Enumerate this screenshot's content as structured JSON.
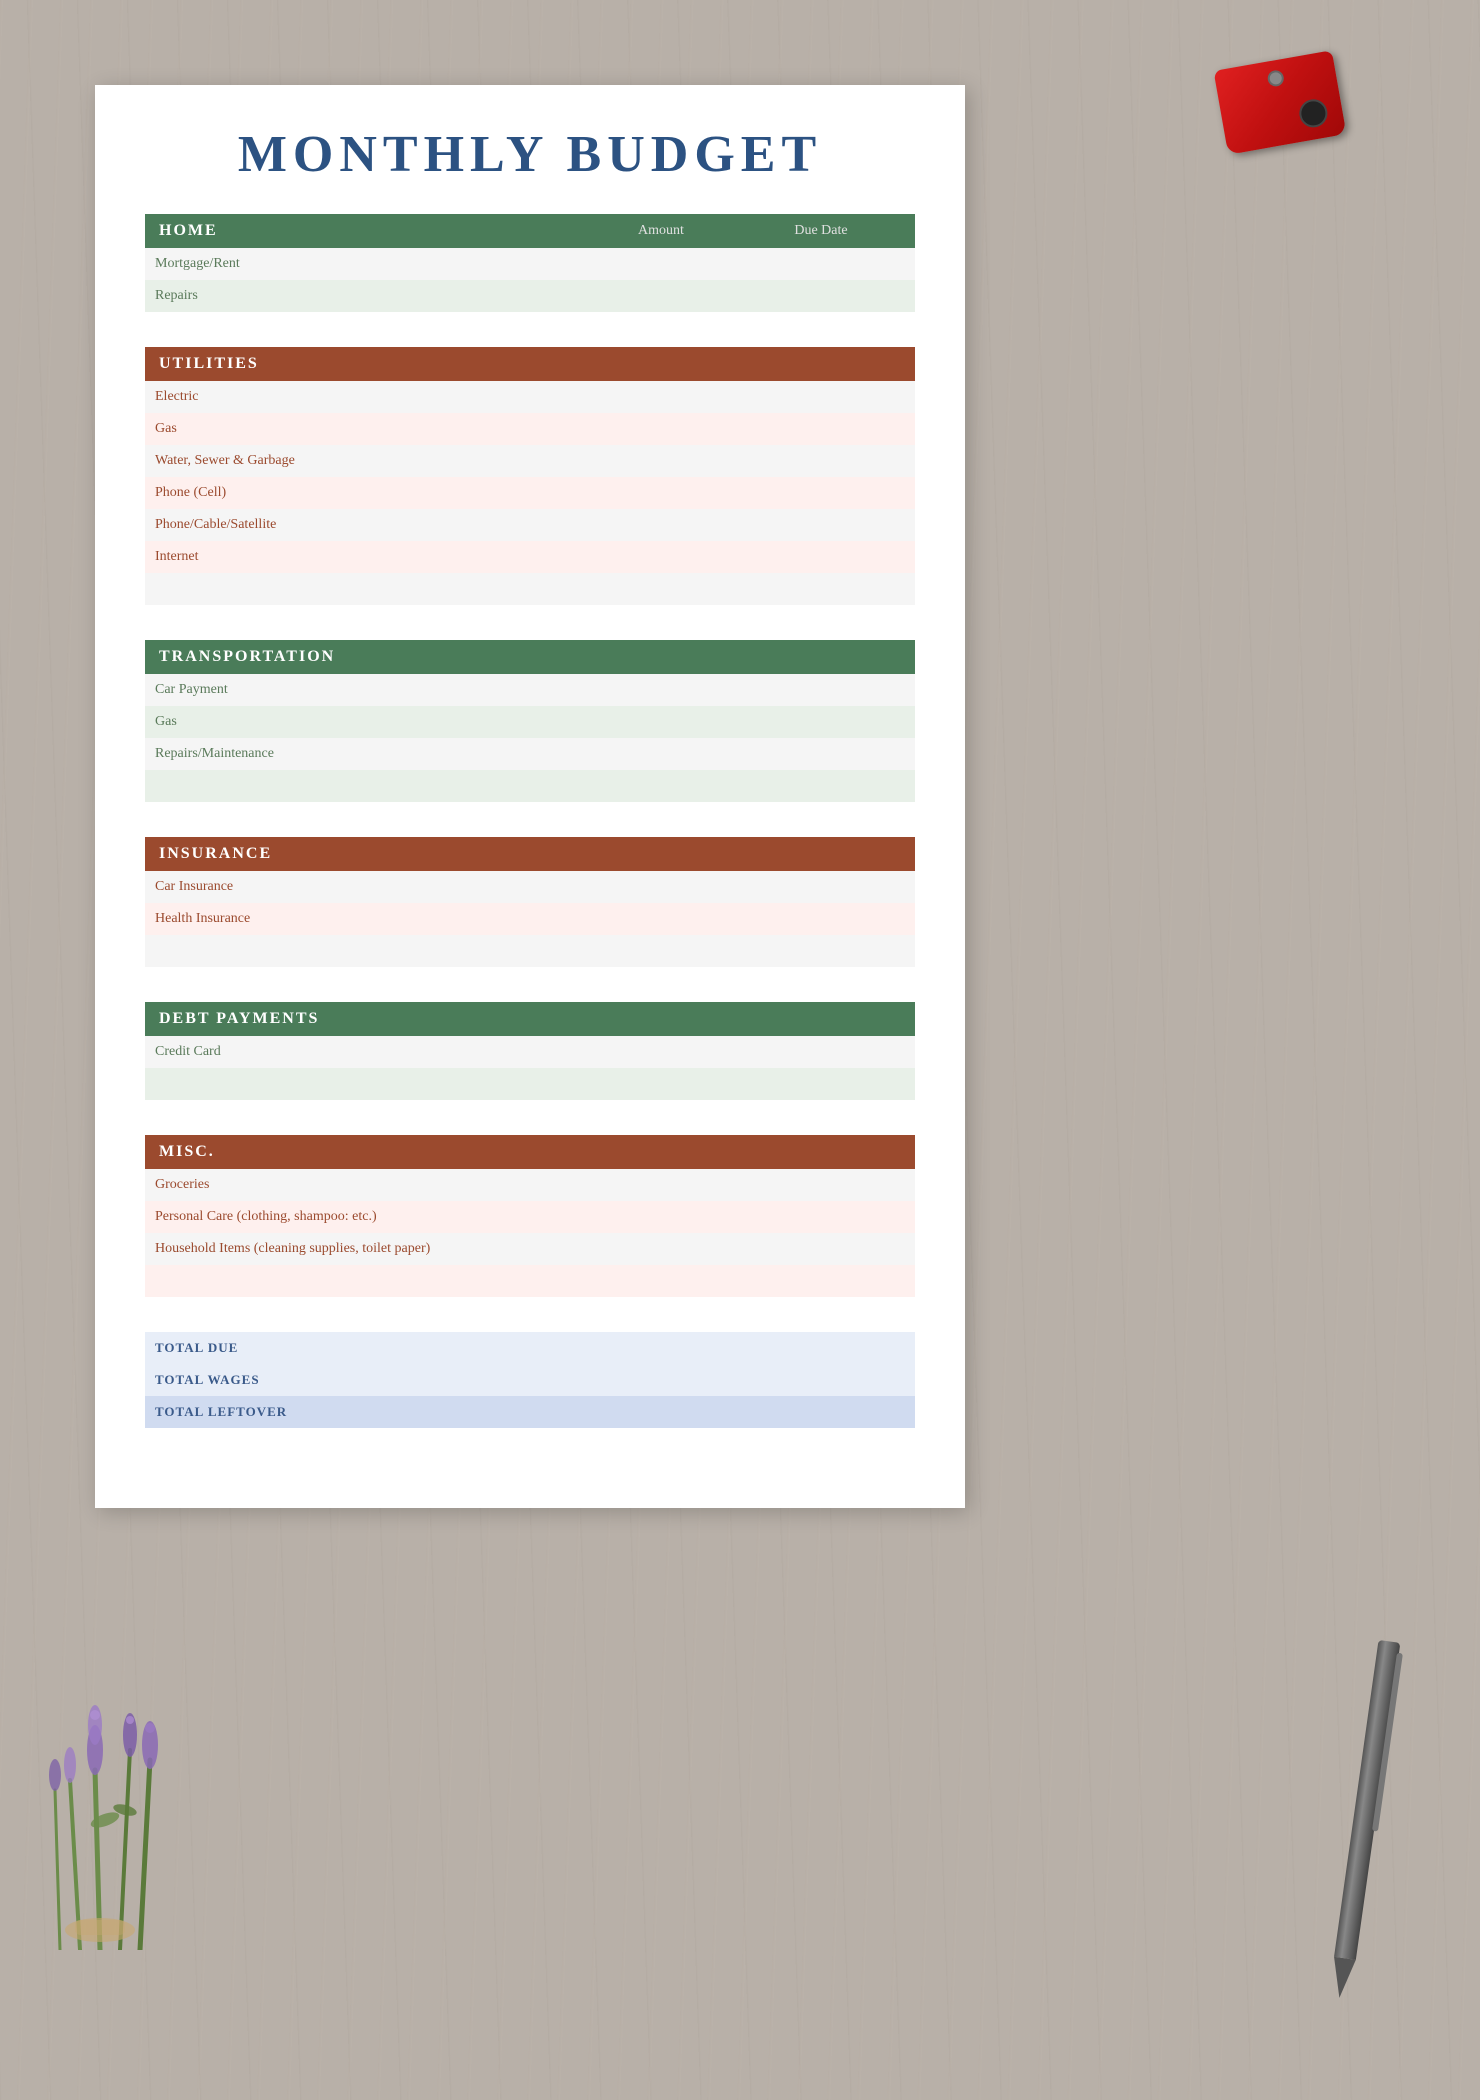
{
  "page": {
    "title": "MONTHLY BUDGET",
    "background_color": "#b8b0a8"
  },
  "sections": [
    {
      "id": "home",
      "title": "HOME",
      "color": "green",
      "col_amount": "Amount",
      "col_duedate": "Due Date",
      "show_columns_in_header": true,
      "items": [
        {
          "label": "Mortgage/Rent",
          "shaded": false
        },
        {
          "label": "Repairs",
          "shaded": true
        }
      ]
    },
    {
      "id": "utilities",
      "title": "UTILITIES",
      "color": "brown",
      "items": [
        {
          "label": "Electric",
          "shaded": false
        },
        {
          "label": "Gas",
          "shaded": true
        },
        {
          "label": "Water, Sewer & Garbage",
          "shaded": false
        },
        {
          "label": "Phone (Cell)",
          "shaded": true
        },
        {
          "label": "Phone/Cable/Satellite",
          "shaded": false
        },
        {
          "label": "Internet",
          "shaded": true
        },
        {
          "label": "",
          "shaded": false
        }
      ]
    },
    {
      "id": "transportation",
      "title": "TRANSPORTATION",
      "color": "green",
      "items": [
        {
          "label": "Car Payment",
          "shaded": false
        },
        {
          "label": "Gas",
          "shaded": true
        },
        {
          "label": "Repairs/Maintenance",
          "shaded": false
        },
        {
          "label": "",
          "shaded": true
        }
      ]
    },
    {
      "id": "insurance",
      "title": "INSURANCE",
      "color": "brown",
      "items": [
        {
          "label": "Car Insurance",
          "shaded": false
        },
        {
          "label": "Health Insurance",
          "shaded": true
        },
        {
          "label": "",
          "shaded": false
        }
      ]
    },
    {
      "id": "debt",
      "title": "DEBT PAYMENTS",
      "color": "green",
      "items": [
        {
          "label": "Credit Card",
          "shaded": false
        },
        {
          "label": "",
          "shaded": true
        }
      ]
    },
    {
      "id": "misc",
      "title": "MISC.",
      "color": "brown",
      "items": [
        {
          "label": "Groceries",
          "shaded": false
        },
        {
          "label": "Personal Care (clothing, shampoo: etc.)",
          "shaded": true
        },
        {
          "label": "Household Items (cleaning supplies, toilet paper)",
          "shaded": false
        },
        {
          "label": "",
          "shaded": true
        }
      ]
    },
    {
      "id": "totals",
      "title": null,
      "color": "blue",
      "items": [
        {
          "label": "TOTAL DUE",
          "shaded": false,
          "label_type": "blue-label"
        },
        {
          "label": "TOTAL WAGES",
          "shaded": false,
          "label_type": "blue-label"
        },
        {
          "label": "TOTAL LEFTOVER",
          "shaded": true,
          "label_type": "blue-label"
        }
      ]
    }
  ]
}
